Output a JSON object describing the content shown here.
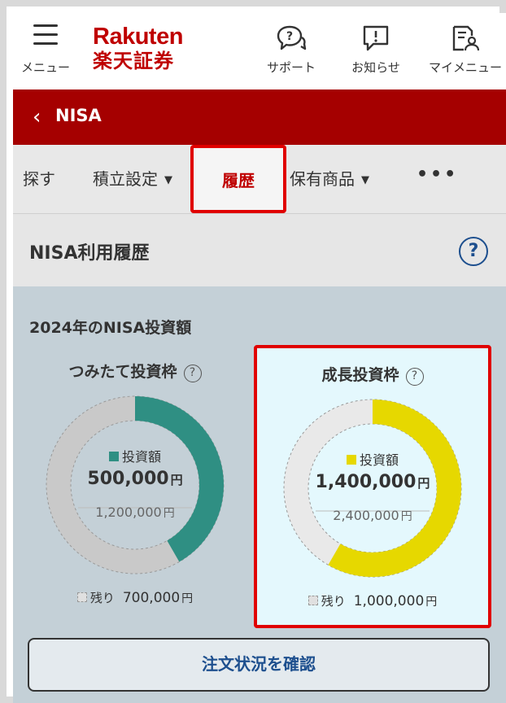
{
  "header": {
    "menu_label": "メニュー",
    "logo_line1": "Rakuten",
    "logo_line2": "楽天証券",
    "support_label": "サポート",
    "notice_label": "お知らせ",
    "mymenu_label": "マイメニュー",
    "brand_color": "#bf0000"
  },
  "nav": {
    "back_icon": "chevron-left-icon",
    "title": "NISA",
    "bar_color": "#a50000"
  },
  "tabs": [
    {
      "label": "探す",
      "dropdown": false
    },
    {
      "label": "積立設定",
      "dropdown": true
    },
    {
      "label": "履歴",
      "active": true
    },
    {
      "label": "保有商品",
      "dropdown": true
    },
    {
      "label": "•••"
    }
  ],
  "section": {
    "title": "NISA利用履歴",
    "help_icon": "?"
  },
  "summary": {
    "year_title": "2024年のNISA投資額",
    "help_icon": "?",
    "invest_label": "投資額",
    "remain_label": "残り",
    "yen": "円"
  },
  "chart_data": [
    {
      "type": "pie",
      "title": "つみたて投資枠",
      "categories": [
        "投資額",
        "残り"
      ],
      "values": [
        500000,
        700000
      ],
      "colors": [
        "#2f8f83",
        "#c9c9c9"
      ],
      "total": 1200000,
      "invested_text": "500,000",
      "total_text": "1,200,000",
      "remain_text": "700,000"
    },
    {
      "type": "pie",
      "title": "成長投資枠",
      "categories": [
        "投資額",
        "残り"
      ],
      "values": [
        1400000,
        1000000
      ],
      "colors": [
        "#e6d800",
        "#e9e9e9"
      ],
      "total": 2400000,
      "invested_text": "1,400,000",
      "total_text": "2,400,000",
      "remain_text": "1,000,000"
    }
  ],
  "button": {
    "label": "注文状況を確認"
  }
}
